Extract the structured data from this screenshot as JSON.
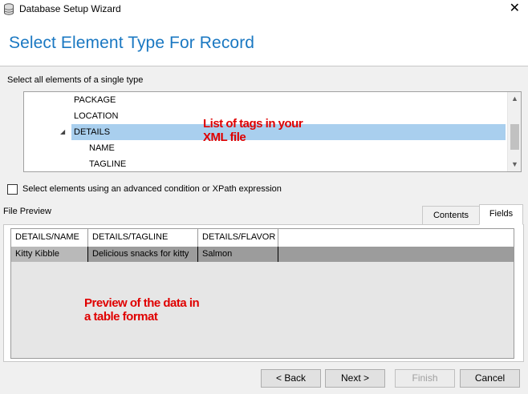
{
  "window": {
    "title": "Database Setup Wizard",
    "close_glyph": "✕"
  },
  "header": {
    "title": "Select Element Type For Record"
  },
  "tree_section": {
    "label": "Select all elements of a single type",
    "items": [
      {
        "label": "PACKAGE",
        "depth": 0,
        "selected": false
      },
      {
        "label": "LOCATION",
        "depth": 0,
        "selected": false
      },
      {
        "label": "DETAILS",
        "depth": 0,
        "selected": true,
        "expander": "◢"
      },
      {
        "label": "NAME",
        "depth": 1,
        "selected": false
      },
      {
        "label": "TAGLINE",
        "depth": 1,
        "selected": false
      }
    ],
    "scroll_up": "▲",
    "scroll_down": "▼"
  },
  "annotations": {
    "tree_note_line1": "List of tags in your",
    "tree_note_line2": "XML file",
    "preview_note_line1": "Preview of the data in",
    "preview_note_line2": "a table format",
    "color": "#e00000"
  },
  "advanced": {
    "label": "Select elements using an advanced condition or XPath expression",
    "checked": false
  },
  "preview": {
    "label": "File Preview",
    "tabs": [
      {
        "label": "Contents",
        "active": false
      },
      {
        "label": "Fields",
        "active": true
      }
    ],
    "columns": [
      "DETAILS/NAME",
      "DETAILS/TAGLINE",
      "DETAILS/FLAVOR"
    ],
    "rows": [
      [
        "Kitty Kibble",
        "Delicious snacks for kitty",
        "Salmon"
      ]
    ]
  },
  "buttons": {
    "back": "< Back",
    "next": "Next >",
    "finish": "Finish",
    "cancel": "Cancel"
  },
  "colors": {
    "title_blue": "#1a78c2",
    "selection": "#a9cfee"
  }
}
